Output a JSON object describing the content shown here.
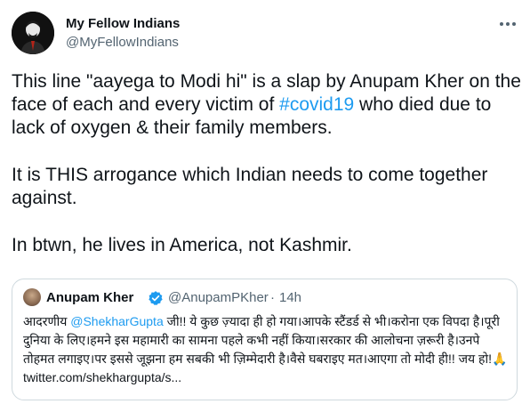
{
  "tweet": {
    "author": {
      "display_name": "My Fellow Indians",
      "handle": "@MyFellowIndians"
    },
    "paragraphs": [
      {
        "before": "This line \"aayega to Modi hi\" is a slap by Anupam Kher on the face of each and every victim of ",
        "hashtag": "#covid19",
        "after": " who died due to lack of oxygen & their family members."
      },
      {
        "text": "It is THIS arrogance which Indian needs to come together against."
      },
      {
        "text": "In btwn, he lives in America, not Kashmir."
      }
    ]
  },
  "quoted_tweet": {
    "display_name": "Anupam Kher",
    "handle": "@AnupamPKher",
    "separator": "·",
    "time": "14h",
    "text_before": "आदरणीय ",
    "mention": "@ShekharGupta",
    "text_after": " जी!! ये कुछ ज़्यादा ही हो गया।आपके स्टैंडर्ड से भी।करोना एक विपदा है।पूरी दुनिया के लिए।हमने इस महामारी का सामना पहले कभी नहीं किया।सरकार की आलोचना ज़रूरी है।उनपे तोहमत लगाइए।पर इससे जूझना हम सबकी भी ज़िम्मेदारी है।वैसे घबराइए मत।आएगा तो मोदी ही!! जय हो!",
    "emoji": "🙏",
    "link": " twitter.com/shekhargupta/s..."
  },
  "icons": {
    "more": "more-options-icon",
    "verified": "verified-badge-icon",
    "accent_color": "#1d9bf0",
    "secondary_text_color": "#536471"
  }
}
